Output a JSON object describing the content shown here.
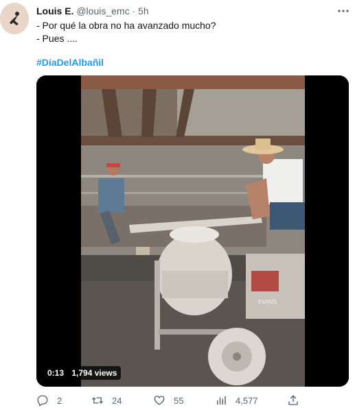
{
  "tweet": {
    "author_name": "Louis E.",
    "author_handle": "@louis_emc",
    "separator": "·",
    "time": "5h",
    "lines": [
      "- Por qué la obra no ha avanzado mucho?",
      "- Pues ...."
    ],
    "hashtag": "#DíaDelAlbañil"
  },
  "video": {
    "timestamp": "0:13",
    "views": "1,794 views",
    "mixer_brand": "EVANS"
  },
  "actions": {
    "replies": "2",
    "retweets": "24",
    "likes": "55",
    "views": "4,577"
  },
  "colors": {
    "link": "#1d9bf0",
    "muted": "#536471",
    "text": "#0f1419"
  },
  "icons": [
    "more-icon",
    "reply-icon",
    "retweet-icon",
    "like-icon",
    "views-icon",
    "share-icon"
  ]
}
